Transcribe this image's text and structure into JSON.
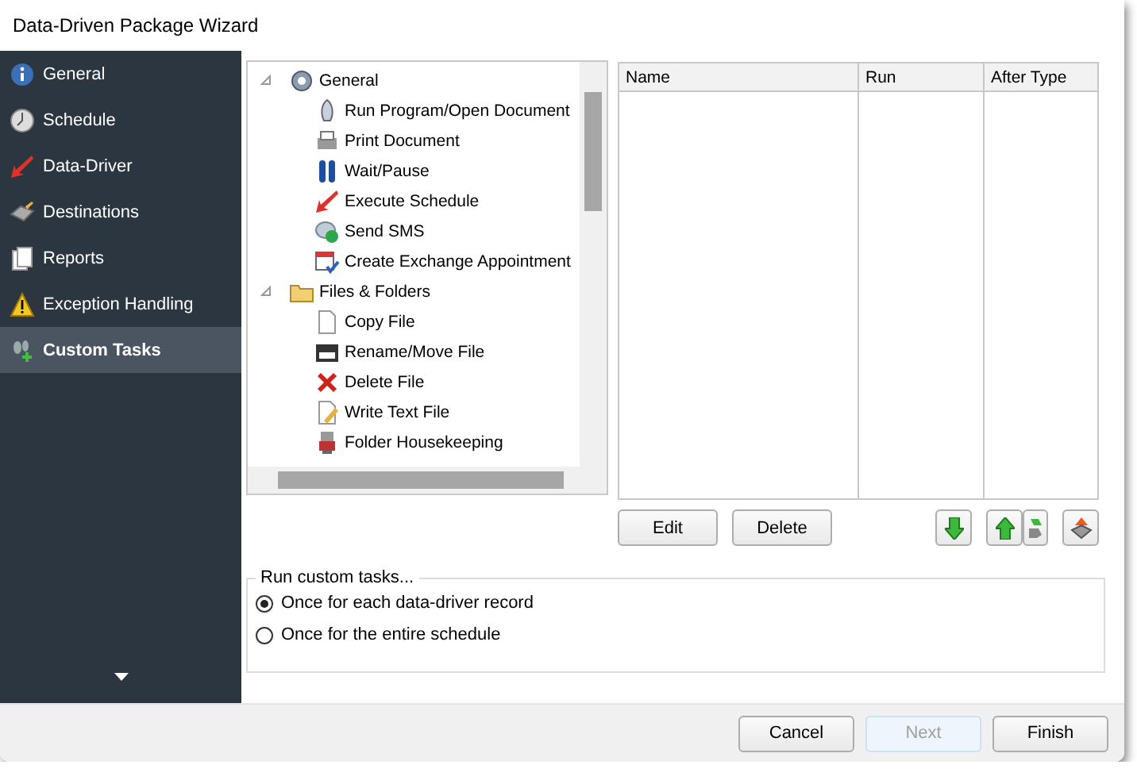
{
  "window": {
    "title": "Data-Driven Package Wizard"
  },
  "sidebar": {
    "items": [
      {
        "label": "General",
        "selected": false
      },
      {
        "label": "Schedule",
        "selected": false
      },
      {
        "label": "Data-Driver",
        "selected": false
      },
      {
        "label": "Destinations",
        "selected": false
      },
      {
        "label": "Reports",
        "selected": false
      },
      {
        "label": "Exception Handling",
        "selected": false
      },
      {
        "label": "Custom Tasks",
        "selected": true
      }
    ]
  },
  "task_tree": [
    {
      "label": "General",
      "expanded": true,
      "children": [
        {
          "label": "Run Program/Open Document"
        },
        {
          "label": "Print Document"
        },
        {
          "label": "Wait/Pause"
        },
        {
          "label": "Execute Schedule"
        },
        {
          "label": "Send SMS"
        },
        {
          "label": "Create Exchange Appointment"
        }
      ]
    },
    {
      "label": "Files & Folders",
      "expanded": true,
      "children": [
        {
          "label": "Copy File"
        },
        {
          "label": "Rename/Move File"
        },
        {
          "label": "Delete File"
        },
        {
          "label": "Write Text File"
        },
        {
          "label": "Folder Housekeeping"
        }
      ]
    }
  ],
  "task_table": {
    "columns": [
      "Name",
      "Run",
      "After Type"
    ]
  },
  "task_buttons": [
    "Edit",
    "Delete"
  ],
  "run_options": {
    "legend": "Run custom tasks...",
    "options": [
      {
        "label": "Once for each data-driver record",
        "selected": true
      },
      {
        "label": "Once for the entire schedule",
        "selected": false
      }
    ]
  },
  "footer_buttons": [
    {
      "label": "Cancel",
      "disabled": false
    },
    {
      "label": "Next",
      "disabled": true
    },
    {
      "label": "Finish",
      "disabled": false
    }
  ]
}
